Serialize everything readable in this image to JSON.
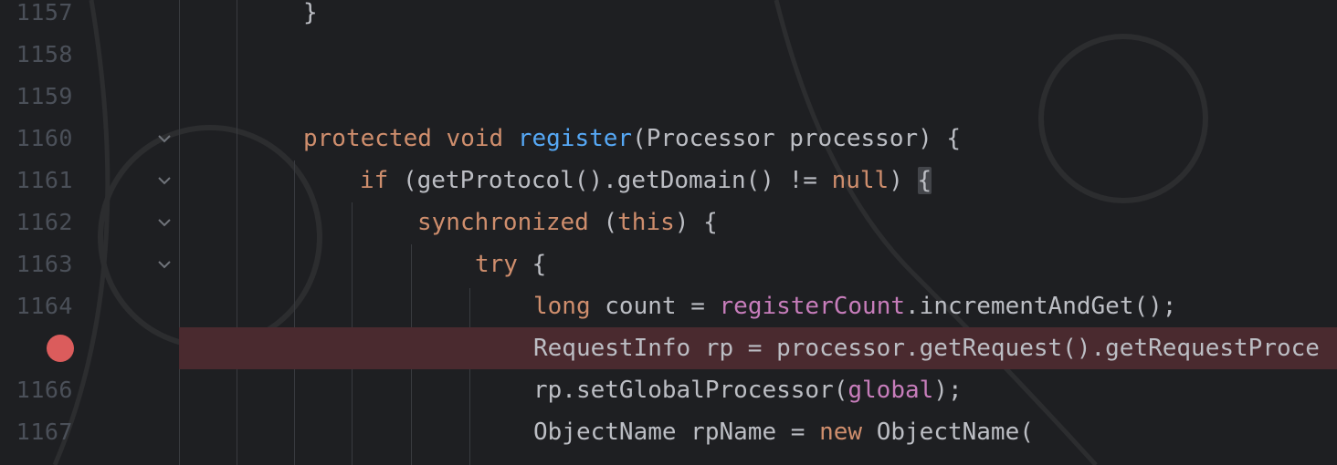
{
  "editor": {
    "lines": [
      {
        "number": "1157",
        "code": [
          "}"
        ],
        "kinds": [
          "plain"
        ],
        "indent": 332
      },
      {
        "number": "1158",
        "code": [],
        "kinds": [],
        "indent": 332
      },
      {
        "number": "1159",
        "code": [],
        "kinds": [],
        "indent": 332
      },
      {
        "number": "1160",
        "code": [
          "protected",
          " ",
          "void",
          " ",
          "register",
          "(Processor processor) {"
        ],
        "kinds": [
          "kw",
          "plain",
          "kw",
          "plain",
          "fn",
          "plain"
        ],
        "indent": 332,
        "fold": true
      },
      {
        "number": "1161",
        "code": [
          "if",
          " (getProtocol().getDomain() != ",
          "null",
          ") ",
          "{"
        ],
        "kinds": [
          "kw",
          "plain",
          "kw",
          "plain",
          "brace"
        ],
        "indent": 394,
        "fold": true
      },
      {
        "number": "1162",
        "code": [
          "synchronized",
          " (",
          "this",
          ") {"
        ],
        "kinds": [
          "kw",
          "plain",
          "kw",
          "plain"
        ],
        "indent": 457,
        "fold": true
      },
      {
        "number": "1163",
        "code": [
          "try",
          " {"
        ],
        "kinds": [
          "kw",
          "plain"
        ],
        "indent": 520,
        "fold": true
      },
      {
        "number": "1164",
        "code": [
          "long",
          " count = ",
          "registerCount",
          ".incrementAndGet();"
        ],
        "kinds": [
          "kw",
          "plain",
          "fld",
          "plain"
        ],
        "indent": 584
      },
      {
        "number": "",
        "code": [
          "RequestInfo rp = processor.getRequest().getRequestProce"
        ],
        "kinds": [
          "plain"
        ],
        "indent": 584,
        "breakpoint": true
      },
      {
        "number": "1166",
        "code": [
          "rp.setGlobalProcessor(",
          "global",
          ");"
        ],
        "kinds": [
          "plain",
          "fld",
          "plain"
        ],
        "indent": 584
      },
      {
        "number": "1167",
        "code": [
          "ObjectName rpName = ",
          "new",
          " ObjectName("
        ],
        "kinds": [
          "plain",
          "kw",
          "plain"
        ],
        "indent": 584
      }
    ]
  },
  "colors": {
    "background": "#1e1f22",
    "keyword": "#cf8e6d",
    "method": "#56a8f5",
    "field": "#c77dbb",
    "text": "#bcbec4",
    "line_number": "#4b5059",
    "breakpoint": "#db5c5c",
    "breakpoint_line": "#4a2a2f"
  },
  "icons": {
    "fold": "chevron-down-icon",
    "breakpoint": "breakpoint-icon"
  }
}
